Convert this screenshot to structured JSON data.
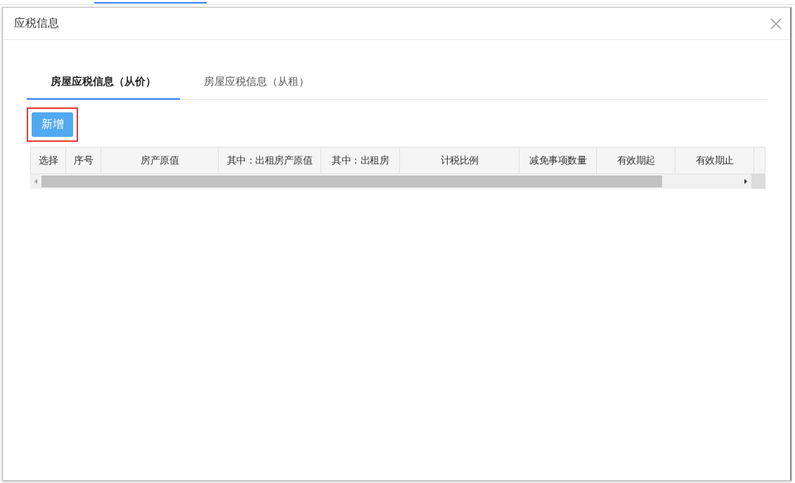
{
  "dialog": {
    "title": "应税信息"
  },
  "tabs": [
    {
      "label": "房屋应税信息（从价）",
      "selected": true
    },
    {
      "label": "房屋应税信息（从租）",
      "selected": false
    }
  ],
  "add_button": {
    "label": "新增",
    "highlighted": true
  },
  "table": {
    "columns": [
      {
        "label": "选择"
      },
      {
        "label": "序号"
      },
      {
        "label": "房产原值"
      },
      {
        "label": "其中：出租房产原值"
      },
      {
        "label": "其中：出租房"
      },
      {
        "label": "计税比例"
      },
      {
        "label": "减免事项数量"
      },
      {
        "label": "有效期起"
      },
      {
        "label": "有效期止"
      }
    ]
  }
}
